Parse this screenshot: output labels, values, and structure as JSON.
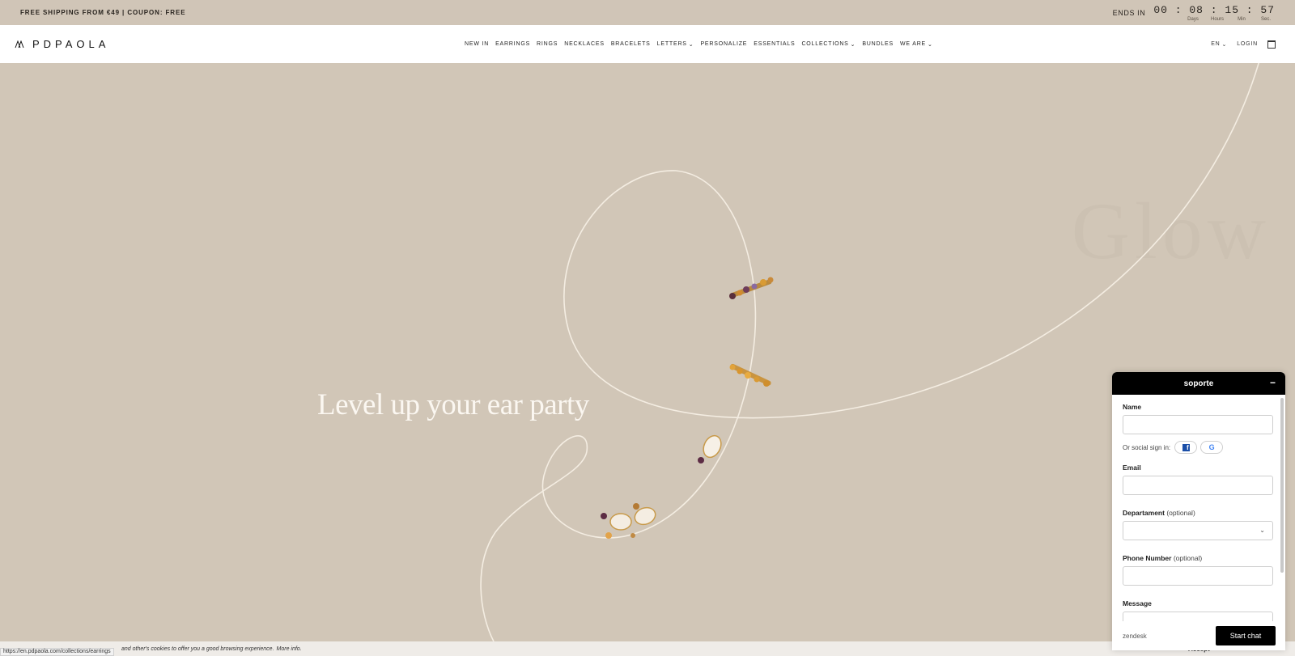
{
  "topbar": {
    "promo": "FREE SHIPPING FROM €49 | COUPON: FREE",
    "ends_in": "ENDS IN",
    "countdown": "00 : 08 : 15 :  57",
    "units": [
      "Days",
      "Hours",
      "Min",
      "Sec."
    ]
  },
  "header": {
    "logo": "PDPAOLA",
    "nav": [
      {
        "label": "NEW IN",
        "dropdown": false
      },
      {
        "label": "EARRINGS",
        "dropdown": false
      },
      {
        "label": "RINGS",
        "dropdown": false
      },
      {
        "label": "NECKLACES",
        "dropdown": false
      },
      {
        "label": "BRACELETS",
        "dropdown": false
      },
      {
        "label": "LETTERS",
        "dropdown": true
      },
      {
        "label": "PERSONALIZE",
        "dropdown": false
      },
      {
        "label": "ESSENTIALS",
        "dropdown": false
      },
      {
        "label": "COLLECTIONS",
        "dropdown": true
      },
      {
        "label": "BUNDLES",
        "dropdown": false
      },
      {
        "label": "WE ARE",
        "dropdown": true
      }
    ],
    "language": "EN",
    "login": "LOGIN",
    "cart_icon": "shopping-bag-icon"
  },
  "hero": {
    "title": "Level up your ear party",
    "ghost_text": "Glow"
  },
  "chat": {
    "title": "soporte",
    "minimize": "−",
    "name_label": "Name",
    "social_label": "Or social sign in:",
    "email_label": "Email",
    "department_label": "Departament",
    "phone_label": "Phone Number",
    "optional": "(optional)",
    "message_label": "Message",
    "brand": "zendesk",
    "start_button": "Start chat"
  },
  "cookie": {
    "text": "and other's cookies to offer you a good browsing experience.",
    "more": "More info.",
    "accept": "Accept"
  },
  "status_url": "https://en.pdpaola.com/collections/earrings",
  "colors": {
    "hero_bg": "#d1c6b7",
    "topbar_bg": "#d0c5b7",
    "chat_header": "#000000"
  }
}
